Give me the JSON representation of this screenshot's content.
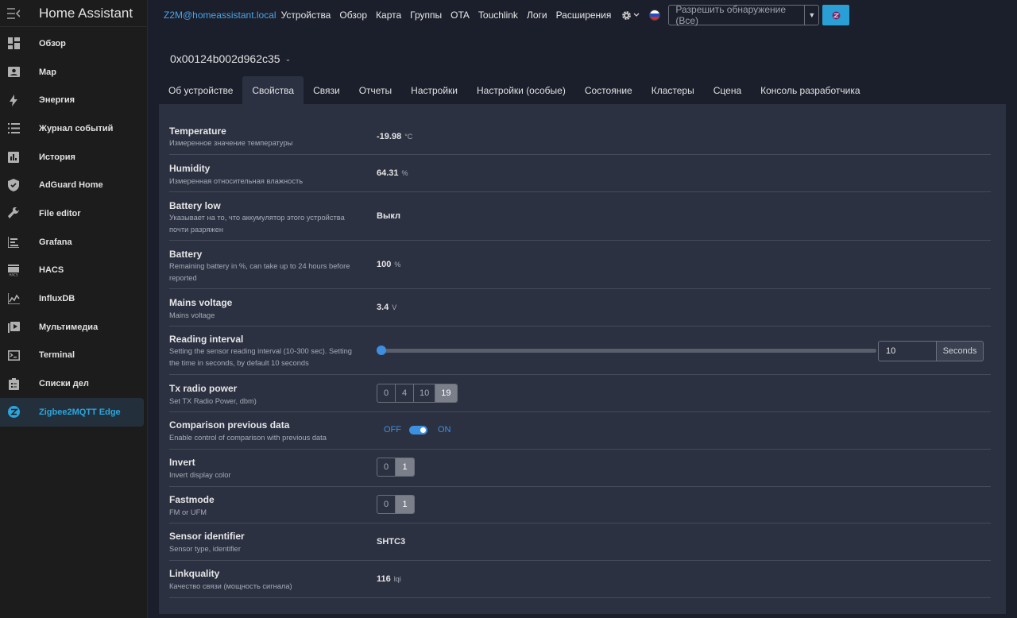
{
  "sidebar": {
    "title": "Home Assistant",
    "items": [
      {
        "label": "Обзор",
        "icon": "dashboard-icon"
      },
      {
        "label": "Map",
        "icon": "map-icon"
      },
      {
        "label": "Энергия",
        "icon": "lightning-icon"
      },
      {
        "label": "Журнал событий",
        "icon": "list-icon"
      },
      {
        "label": "История",
        "icon": "chart-icon"
      },
      {
        "label": "AdGuard Home",
        "icon": "shield-icon"
      },
      {
        "label": "File editor",
        "icon": "wrench-icon"
      },
      {
        "label": "Grafana",
        "icon": "grafana-icon"
      },
      {
        "label": "HACS",
        "icon": "hacs-icon"
      },
      {
        "label": "InfluxDB",
        "icon": "graph-icon"
      },
      {
        "label": "Мультимедиа",
        "icon": "play-icon"
      },
      {
        "label": "Terminal",
        "icon": "terminal-icon"
      },
      {
        "label": "Списки дел",
        "icon": "clipboard-icon"
      },
      {
        "label": "Zigbee2MQTT Edge",
        "icon": "zigbee-icon",
        "active": true
      }
    ]
  },
  "topbar": {
    "host": "Z2M@homeassistant.local",
    "nav": [
      "Устройства",
      "Обзор",
      "Карта",
      "Группы",
      "OTA",
      "Touchlink",
      "Логи",
      "Расширения"
    ],
    "permit_select": "Разрешить обнаружение (Все)"
  },
  "device": {
    "name": "0x00124b002d962c35"
  },
  "tabs": [
    "Об устройстве",
    "Свойства",
    "Связи",
    "Отчеты",
    "Настройки",
    "Настройки (особые)",
    "Состояние",
    "Кластеры",
    "Сцена",
    "Консоль разработчика"
  ],
  "active_tab": 1,
  "properties": {
    "temperature": {
      "name": "Temperature",
      "desc": "Измеренное значение температуры",
      "value": "-19.98",
      "unit": "°C"
    },
    "humidity": {
      "name": "Humidity",
      "desc": "Измеренная относительная влажность",
      "value": "64.31",
      "unit": "%"
    },
    "battery_low": {
      "name": "Battery low",
      "desc": "Указывает на то, что аккумулятор этого устройства почти разряжен",
      "value": "Выкл"
    },
    "battery": {
      "name": "Battery",
      "desc": "Remaining battery in %, can take up to 24 hours before reported",
      "value": "100",
      "unit": "%"
    },
    "mains_voltage": {
      "name": "Mains voltage",
      "desc": "Mains voltage",
      "value": "3.4",
      "unit": "V"
    },
    "reading_interval": {
      "name": "Reading interval",
      "desc": "Setting the sensor reading interval (10-300 sec). Setting the time in seconds, by default 10 seconds",
      "value": "10",
      "unit": "Seconds",
      "min": 10,
      "max": 300
    },
    "tx_power": {
      "name": "Tx radio power",
      "desc": "Set TX Radio Power, dbm)",
      "options": [
        "0",
        "4",
        "10",
        "19"
      ],
      "selected": "19"
    },
    "comparison": {
      "name": "Comparison previous data",
      "desc": "Enable control of comparison with previous data",
      "off_label": "OFF",
      "on_label": "ON",
      "state": "ON"
    },
    "invert": {
      "name": "Invert",
      "desc": "Invert display color",
      "options": [
        "0",
        "1"
      ],
      "selected": "1"
    },
    "fastmode": {
      "name": "Fastmode",
      "desc": "FM or UFM",
      "options": [
        "0",
        "1"
      ],
      "selected": "1"
    },
    "sensor_identifier": {
      "name": "Sensor identifier",
      "desc": "Sensor type, identifier",
      "value": "SHTC3"
    },
    "linkquality": {
      "name": "Linkquality",
      "desc": "Качество связи (мощность сигнала)",
      "value": "116",
      "unit": "lqi"
    }
  },
  "colors": {
    "accent": "#2ba5df",
    "toggle": "#3d8fe0",
    "panel": "#2c3142",
    "background": "#1b1f2b"
  }
}
